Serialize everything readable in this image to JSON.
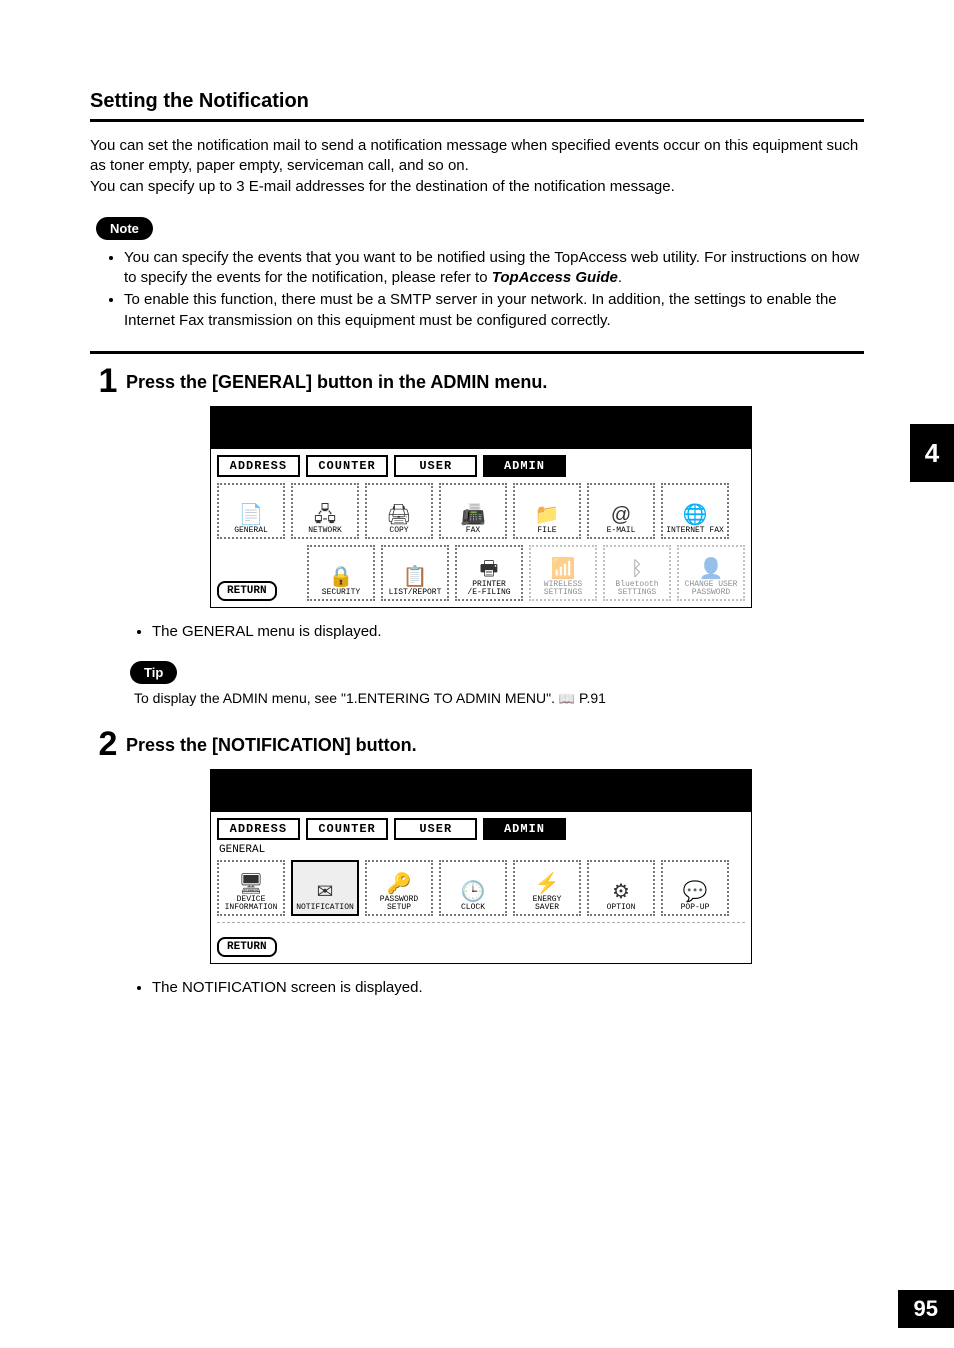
{
  "section_title": "Setting the Notification",
  "intro_p1": "You can set the notification mail to send a notification message when specified events occur on this equipment such as toner empty, paper empty, serviceman call, and so on.",
  "intro_p2": "You can specify up to 3 E-mail addresses for the destination of the notification message.",
  "note_label": "Note",
  "note_items": [
    {
      "pre": "You can specify the events that you want to be notified using the TopAccess web utility.  For instructions on how to specify the events for the notification, please refer to ",
      "ref": "TopAccess Guide",
      "post": "."
    },
    {
      "text": "To enable this function, there must be a SMTP server in your network.  In addition, the settings to enable the Internet Fax transmission on this equipment must be configured correctly."
    }
  ],
  "steps": [
    {
      "num": "1",
      "title": "Press the [GENERAL] button in the ADMIN menu.",
      "bullet": "The GENERAL menu is displayed.",
      "screen": {
        "tabs": [
          "ADDRESS",
          "COUNTER",
          "USER",
          "ADMIN"
        ],
        "active_tab": 3,
        "row1": [
          {
            "glyph": "📄",
            "label": "GENERAL"
          },
          {
            "glyph": "🖧",
            "label": "NETWORK"
          },
          {
            "glyph": "🖨",
            "label": "COPY"
          },
          {
            "glyph": "📠",
            "label": "FAX"
          },
          {
            "glyph": "📁",
            "label": "FILE"
          },
          {
            "glyph": "@",
            "label": "E-MAIL"
          },
          {
            "glyph": "🌐",
            "label": "INTERNET FAX"
          }
        ],
        "row2": [
          {
            "glyph": "🔒",
            "label": "SECURITY"
          },
          {
            "glyph": "📋",
            "label": "LIST/REPORT"
          },
          {
            "glyph": "🖶",
            "label": "PRINTER\n/E-FILING"
          },
          {
            "glyph": "📶",
            "label": "WIRELESS\nSETTINGS",
            "dim": true
          },
          {
            "glyph": "ᛒ",
            "label": "Bluetooth\nSETTINGS",
            "dim": true
          },
          {
            "glyph": "👤",
            "label": "CHANGE USER\nPASSWORD",
            "dim": true
          }
        ],
        "return": "RETURN"
      }
    },
    {
      "num": "2",
      "title": "Press the [NOTIFICATION] button.",
      "bullet": "The NOTIFICATION screen is displayed.",
      "screen": {
        "tabs": [
          "ADDRESS",
          "COUNTER",
          "USER",
          "ADMIN"
        ],
        "active_tab": 3,
        "breadcrumb": "GENERAL",
        "row1": [
          {
            "glyph": "🖥",
            "label": "DEVICE\nINFORMATION"
          },
          {
            "glyph": "✉",
            "label": "NOTIFICATION",
            "selected": true
          },
          {
            "glyph": "🔑",
            "label": "PASSWORD SETUP"
          },
          {
            "glyph": "🕒",
            "label": "CLOCK"
          },
          {
            "glyph": "⚡",
            "label": "ENERGY\nSAVER"
          },
          {
            "glyph": "⚙",
            "label": "OPTION"
          },
          {
            "glyph": "💬",
            "label": "POP-UP"
          }
        ],
        "return": "RETURN"
      }
    }
  ],
  "tip_label": "Tip",
  "tip_text_pre": "To display the ADMIN menu, see \"1.ENTERING TO ADMIN MENU\".  ",
  "tip_text_post": " P.91",
  "side_chapter": "4",
  "page_number": "95"
}
